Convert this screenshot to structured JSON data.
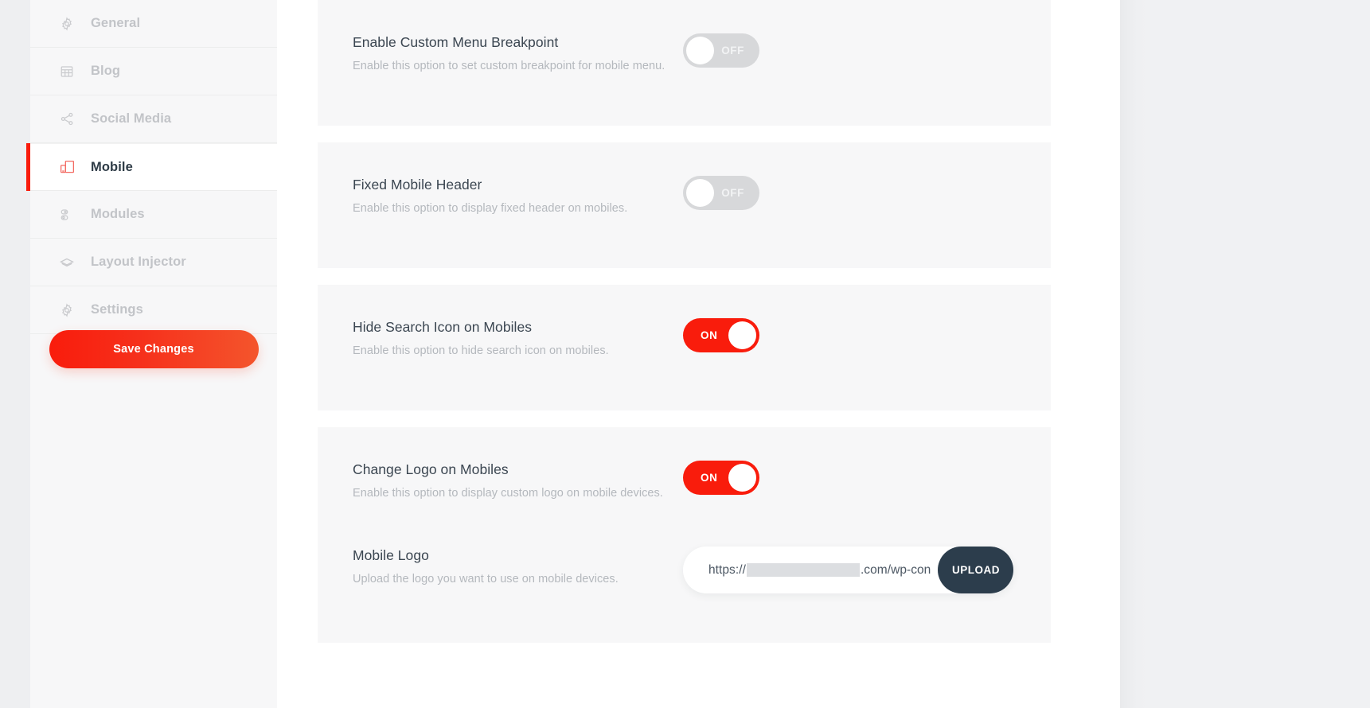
{
  "sidebar": {
    "items": [
      {
        "label": "General",
        "icon": "gear-icon",
        "active": false
      },
      {
        "label": "Blog",
        "icon": "grid-icon",
        "active": false
      },
      {
        "label": "Social Media",
        "icon": "share-icon",
        "active": false
      },
      {
        "label": "Mobile",
        "icon": "mobile-icon",
        "active": true
      },
      {
        "label": "Modules",
        "icon": "modules-icon",
        "active": false
      },
      {
        "label": "Layout Injector",
        "icon": "layers-icon",
        "active": false
      },
      {
        "label": "Settings",
        "icon": "gear-icon",
        "active": false
      }
    ],
    "save_label": "Save Changes"
  },
  "options": [
    {
      "title": "Enable Custom Menu Breakpoint",
      "desc": "Enable this option to set custom breakpoint for mobile menu.",
      "toggle_state": "OFF"
    },
    {
      "title": "Fixed Mobile Header",
      "desc": "Enable this option to display fixed header on mobiles.",
      "toggle_state": "OFF"
    },
    {
      "title": "Hide Search Icon on Mobiles",
      "desc": "Enable this option to hide search icon on mobiles.",
      "toggle_state": "ON"
    },
    {
      "title": "Change Logo on Mobiles",
      "desc": "Enable this option to display custom logo on mobile devices.",
      "toggle_state": "ON"
    },
    {
      "title": "Mobile Logo",
      "desc": "Upload the logo you want to use on mobile devices.",
      "url_prefix": "https://",
      "url_suffix": ".com/wp-con",
      "upload_label": "UPLOAD"
    }
  ],
  "colors": {
    "accent": "#f91c0c",
    "toggle_off": "#d7d8da",
    "upload_button": "#2c3d4c",
    "title_text": "#3b4651",
    "muted_text": "#b4b8bd"
  }
}
